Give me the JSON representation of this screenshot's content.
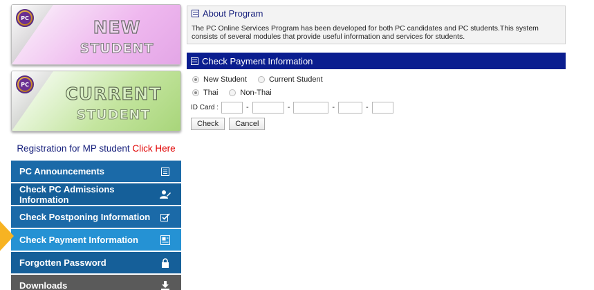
{
  "banners": {
    "new": {
      "logo_text": "PC",
      "line1": "NEW",
      "line2": "STUDENT"
    },
    "current": {
      "logo_text": "PC",
      "line1": "CURRENT",
      "line2": "STUDENT"
    }
  },
  "mp_registration": {
    "text": "Registration for MP student ",
    "link": "Click Here"
  },
  "side_menu": {
    "items": [
      {
        "label": "PC Announcements",
        "icon": "list-icon"
      },
      {
        "label": "Check PC Admissions Information",
        "icon": "user-edit-icon"
      },
      {
        "label": "Check Postponing Information",
        "icon": "checkbox-edit-icon"
      },
      {
        "label": "Check Payment Information",
        "icon": "card-icon",
        "active": true
      },
      {
        "label": "Forgotten Password",
        "icon": "lock-icon"
      },
      {
        "label": "Downloads",
        "icon": "download-icon"
      }
    ]
  },
  "about": {
    "title": "About Program",
    "text": "The PC Online Services Program has been developed for both PC candidates and PC students.This system consists of several modules that provide useful information and services for students."
  },
  "payment": {
    "title": "Check Payment Information",
    "student_type": {
      "options": [
        "New Student",
        "Current Student"
      ],
      "selected": "New Student"
    },
    "nationality": {
      "options": [
        "Thai",
        "Non-Thai"
      ],
      "selected": "Thai"
    },
    "id_label": "ID Card :",
    "id_separator": "-",
    "check_button": "Check",
    "cancel_button": "Cancel"
  },
  "colors": {
    "menu_blue": "#1b6aa8",
    "menu_active": "#2592d4",
    "menu_downloads": "#5a5a5a",
    "header_navy": "#0a1d8f",
    "arrow_orange": "#f7b322",
    "link_red": "#e10000"
  }
}
